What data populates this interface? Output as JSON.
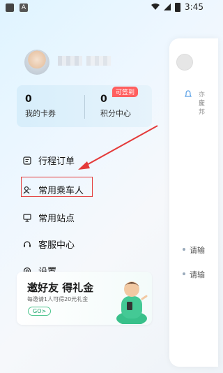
{
  "status_bar": {
    "time": "3:45",
    "left_badge": "A"
  },
  "profile": {
    "avatar": "user-avatar"
  },
  "stats": {
    "coupons": {
      "value": "0",
      "label": "我的卡券"
    },
    "points": {
      "value": "0",
      "label": "积分中心",
      "badge": "可签到"
    }
  },
  "menu": [
    {
      "label": "行程订单",
      "icon": "order-list-icon"
    },
    {
      "label": "常用乘车人",
      "icon": "passenger-icon"
    },
    {
      "label": "常用站点",
      "icon": "station-icon"
    },
    {
      "label": "客服中心",
      "icon": "headset-icon"
    },
    {
      "label": "设置",
      "icon": "settings-icon"
    }
  ],
  "banner": {
    "title": "邀好友 得礼金",
    "subtitle": "每邀请1人可得20元礼金",
    "cta": "GO>"
  },
  "background_page": {
    "text1": "亦庄",
    "text2": "安邦",
    "item1": "请输",
    "item2": "请输"
  },
  "colors": {
    "highlight": "#e43a3a",
    "badge": "#ff5f5f",
    "accent": "#1aa46a"
  }
}
